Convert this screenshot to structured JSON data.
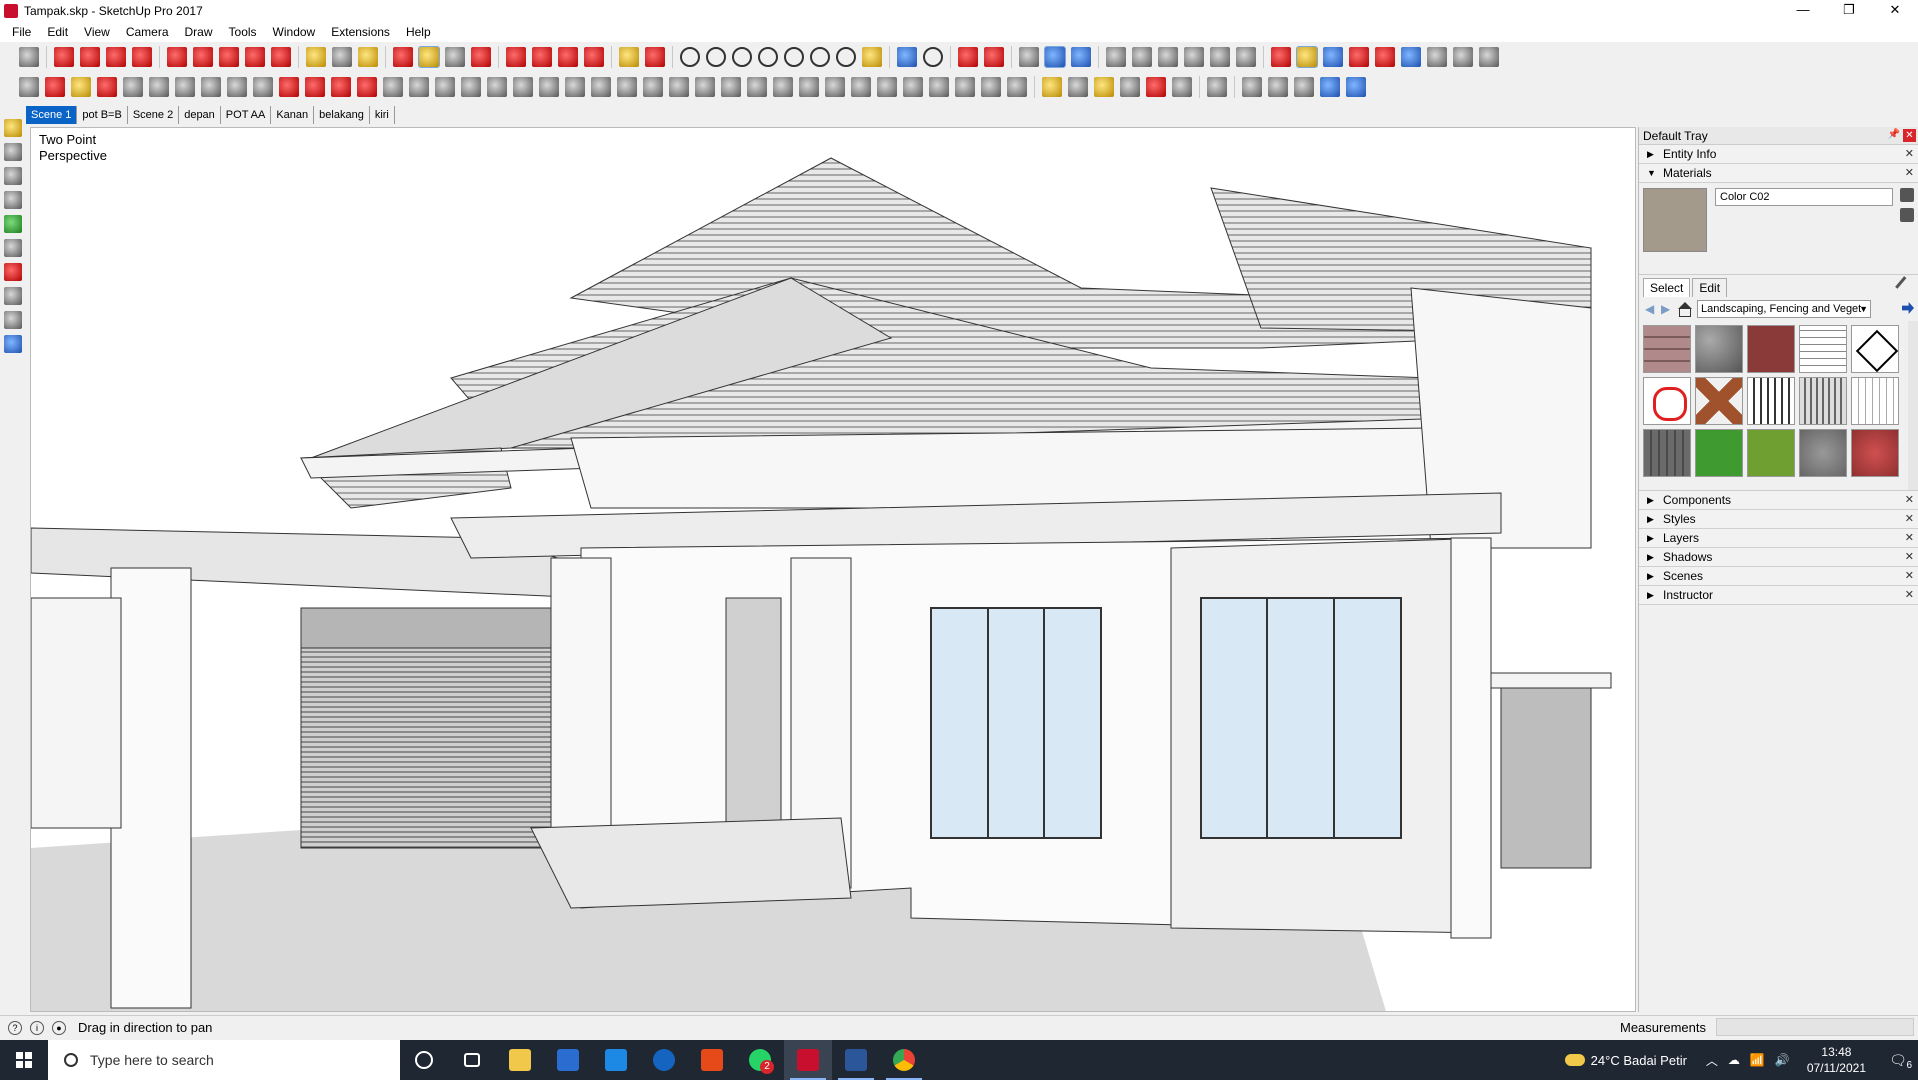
{
  "window": {
    "title": "Tampak.skp - SketchUp Pro 2017",
    "controls": [
      "—",
      "❐",
      "✕"
    ]
  },
  "menu": [
    "File",
    "Edit",
    "View",
    "Camera",
    "Draw",
    "Tools",
    "Window",
    "Extensions",
    "Help"
  ],
  "scenes": {
    "tabs": [
      "Scene 1",
      "pot B=B",
      "Scene 2",
      "depan",
      "POT AA",
      "Kanan",
      "belakang",
      "kiri"
    ],
    "active": "Scene 1"
  },
  "viewport": {
    "camera_line1": "Two Point",
    "camera_line2": "Perspective"
  },
  "tray": {
    "title": "Default Tray",
    "panels_top": [
      "Entity Info",
      "Materials"
    ],
    "material_name": "Color C02",
    "material_color": "#a39a8b",
    "tabs": [
      "Select",
      "Edit"
    ],
    "library": "Landscaping, Fencing and Veget",
    "panels_bottom": [
      "Components",
      "Styles",
      "Layers",
      "Shadows",
      "Scenes",
      "Instructor"
    ]
  },
  "statusbar": {
    "hint": "Drag in direction to pan",
    "measurements_label": "Measurements"
  },
  "taskbar": {
    "search_placeholder": "Type here to search",
    "weather": "24°C  Badai Petir",
    "time": "13:48",
    "date": "07/11/2021",
    "chat_badge": "2",
    "notification_count": "6"
  },
  "colors": {
    "accent": "#0a64c8",
    "taskbar": "#1f2733",
    "close": "#d9242b"
  }
}
